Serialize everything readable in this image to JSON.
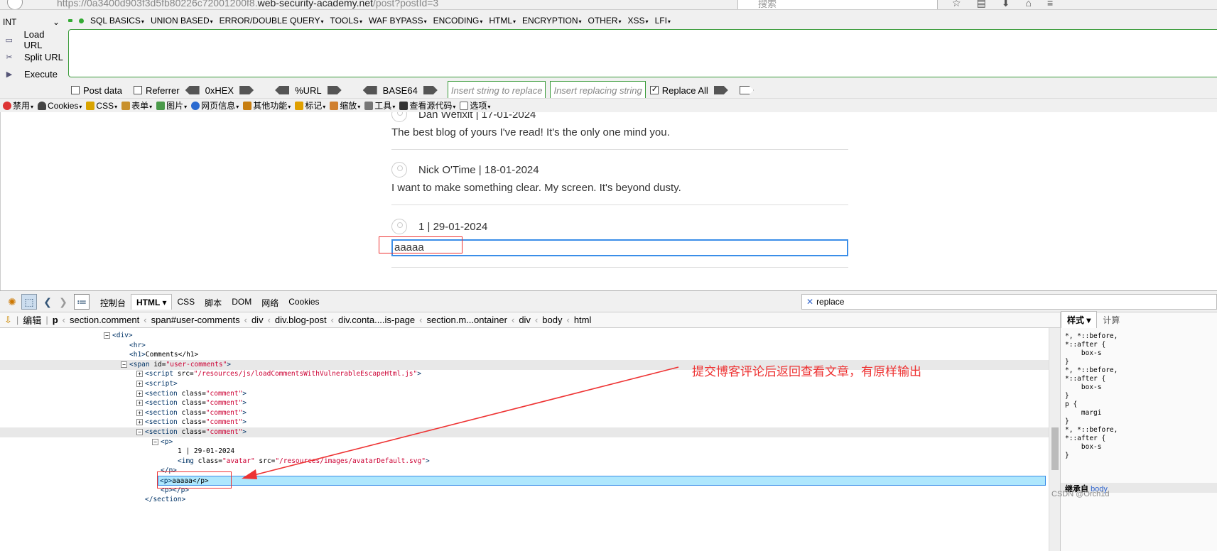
{
  "browser": {
    "url_prefix": "https://0a3400d903f3d5fb80226c72001200f8.",
    "url_host": "web-security-academy.net",
    "url_path": "/post?postId=3",
    "search_placeholder": "搜索"
  },
  "hackbar": {
    "method": "INT",
    "menu": [
      "SQL BASICS",
      "UNION BASED",
      "ERROR/DOUBLE QUERY",
      "TOOLS",
      "WAF BYPASS",
      "ENCODING",
      "HTML",
      "ENCRYPTION",
      "OTHER",
      "XSS",
      "LFI"
    ],
    "actions": [
      "Load URL",
      "Split URL",
      "Execute"
    ],
    "post_data_label": "Post data",
    "referrer_label": "Referrer",
    "hex_label": "0xHEX",
    "url_label": "%URL",
    "base64_label": "BASE64",
    "replace_placeholder": "Insert string to replace",
    "replacing_placeholder": "Insert replacing string",
    "replace_all_label": "Replace All"
  },
  "webdev_toolbar": [
    "禁用",
    "Cookies",
    "CSS",
    "表单",
    "图片",
    "网页信息",
    "其他功能",
    "标记",
    "缩放",
    "工具",
    "查看源代码",
    "选项"
  ],
  "comments": [
    {
      "header": "Dan Wefixit | 17-01-2024",
      "body": "The best blog of yours I've read! It's the only one mind you."
    },
    {
      "header": "Nick O'Time | 18-01-2024",
      "body": "I want to make something clear. My screen. It's beyond dusty."
    },
    {
      "header": "1 | 29-01-2024",
      "body": "aaaaa"
    }
  ],
  "devtools": {
    "tabs": [
      "控制台",
      "HTML",
      "CSS",
      "脚本",
      "DOM",
      "网络",
      "Cookies"
    ],
    "search_value": "replace",
    "edit_label": "编辑",
    "breadcrumbs": [
      "p",
      "section.comment",
      "span#user-comments",
      "div",
      "div.blog-post",
      "div.conta....is-page",
      "section.m...ontainer",
      "div",
      "body",
      "html"
    ],
    "side_tabs": [
      "样式",
      "计算"
    ],
    "side_rules": [
      "*, *::before,",
      "*::after {",
      "    box-s",
      "}",
      "*, *::before,",
      "*::after {",
      "    box-s",
      "}",
      "p {",
      "    margi",
      "}",
      "*, *::before,",
      "*::after {",
      "    box-s",
      "}"
    ],
    "inherited_label": "继承自",
    "inherited_from": "body",
    "tree": [
      {
        "indent": 0,
        "tw": "⊟",
        "tag": "<div>",
        "attrs": [],
        "end": "",
        "hl": false
      },
      {
        "indent": 1,
        "tw": "",
        "tag": "<hr>",
        "attrs": [],
        "end": "",
        "hl": false
      },
      {
        "indent": 1,
        "tw": "",
        "tag": "<h1>",
        "attrs": [],
        "end": "Comments</h1>",
        "hl": false
      },
      {
        "indent": 1,
        "tw": "⊟",
        "tag": "<span",
        "attrs": [
          [
            "id",
            "\"user-comments\""
          ]
        ],
        "end": ">",
        "hl": true
      },
      {
        "indent": 2,
        "tw": "⊞",
        "tag": "<script",
        "attrs": [
          [
            "src",
            "\"/resources/js/loadCommentsWithVulnerableEscapeHtml.js\""
          ]
        ],
        "end": ">",
        "hl": false
      },
      {
        "indent": 2,
        "tw": "⊞",
        "tag": "<script>",
        "attrs": [],
        "end": "",
        "hl": false
      },
      {
        "indent": 2,
        "tw": "⊞",
        "tag": "<section",
        "attrs": [
          [
            "class",
            "\"comment\""
          ]
        ],
        "end": ">",
        "hl": false
      },
      {
        "indent": 2,
        "tw": "⊞",
        "tag": "<section",
        "attrs": [
          [
            "class",
            "\"comment\""
          ]
        ],
        "end": ">",
        "hl": false
      },
      {
        "indent": 2,
        "tw": "⊞",
        "tag": "<section",
        "attrs": [
          [
            "class",
            "\"comment\""
          ]
        ],
        "end": ">",
        "hl": false
      },
      {
        "indent": 2,
        "tw": "⊞",
        "tag": "<section",
        "attrs": [
          [
            "class",
            "\"comment\""
          ]
        ],
        "end": ">",
        "hl": false
      },
      {
        "indent": 2,
        "tw": "⊟",
        "tag": "<section",
        "attrs": [
          [
            "class",
            "\"comment\""
          ]
        ],
        "end": ">",
        "hl": true
      },
      {
        "indent": 3,
        "tw": "⊟",
        "tag": "<p>",
        "attrs": [],
        "end": "",
        "hl": false
      },
      {
        "indent": 4,
        "tw": "",
        "tag": "",
        "attrs": [],
        "end": "1 | 29-01-2024",
        "hl": false
      },
      {
        "indent": 4,
        "tw": "",
        "tag": "<img",
        "attrs": [
          [
            "class",
            "\"avatar\""
          ],
          [
            "src",
            "\"/resources/images/avatarDefault.svg\""
          ]
        ],
        "end": ">",
        "hl": false
      },
      {
        "indent": 3,
        "tw": "",
        "tag": "</p>",
        "attrs": [],
        "end": "",
        "hl": false
      },
      {
        "indent": 3,
        "tw": "",
        "tag": "<p>",
        "attrs": [],
        "end": "aaaaa</p>",
        "hl": false,
        "sel": true
      },
      {
        "indent": 3,
        "tw": "",
        "tag": "<p>",
        "attrs": [],
        "end": "</p>",
        "hl": false
      },
      {
        "indent": 2,
        "tw": "",
        "tag": "</section>",
        "attrs": [],
        "end": "",
        "hl": false
      }
    ]
  },
  "annotation": "提交博客评论后返回查看文章，有原样输出",
  "watermark": "CSDN @Orch1d",
  "colors": {
    "accent_green": "#3c9c3c",
    "select_blue": "#3b8ee8",
    "annotation_red": "#e33333"
  }
}
